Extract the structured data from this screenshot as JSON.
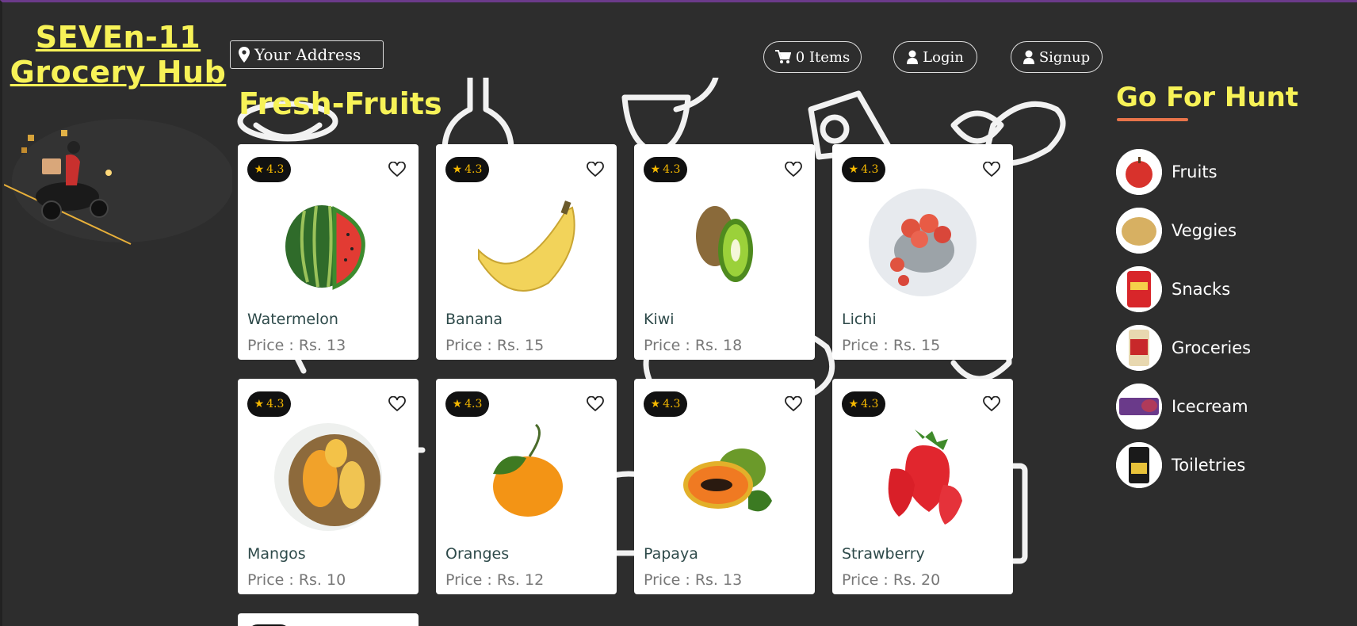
{
  "brand": {
    "line1": "SEVEn-11",
    "line2": "Grocery Hub"
  },
  "header": {
    "address_label": "Your Address",
    "cart_label": "0 Items",
    "login_label": "Login",
    "signup_label": "Signup"
  },
  "section_title": "Fresh-Fruits",
  "products": [
    {
      "name": "Watermelon",
      "price": "Price : Rs. 13",
      "rating": "4.3"
    },
    {
      "name": "Banana",
      "price": "Price : Rs. 15",
      "rating": "4.3"
    },
    {
      "name": "Kiwi",
      "price": "Price : Rs. 18",
      "rating": "4.3"
    },
    {
      "name": "Lichi",
      "price": "Price : Rs. 15",
      "rating": "4.3"
    },
    {
      "name": "Mangos",
      "price": "Price : Rs. 10",
      "rating": "4.3"
    },
    {
      "name": "Oranges",
      "price": "Price : Rs. 12",
      "rating": "4.3"
    },
    {
      "name": "Papaya",
      "price": "Price : Rs. 13",
      "rating": "4.3"
    },
    {
      "name": "Strawberry",
      "price": "Price : Rs. 20",
      "rating": "4.3"
    }
  ],
  "sidebar": {
    "title": "Go For Hunt",
    "categories": [
      {
        "label": "Fruits"
      },
      {
        "label": "Veggies"
      },
      {
        "label": "Snacks"
      },
      {
        "label": "Groceries"
      },
      {
        "label": "Icecream"
      },
      {
        "label": "Toiletries"
      }
    ]
  },
  "colors": {
    "accent_yellow": "#f7f257",
    "background": "#2d2d2d",
    "star": "#f5b800",
    "underline": "#e8744a"
  }
}
